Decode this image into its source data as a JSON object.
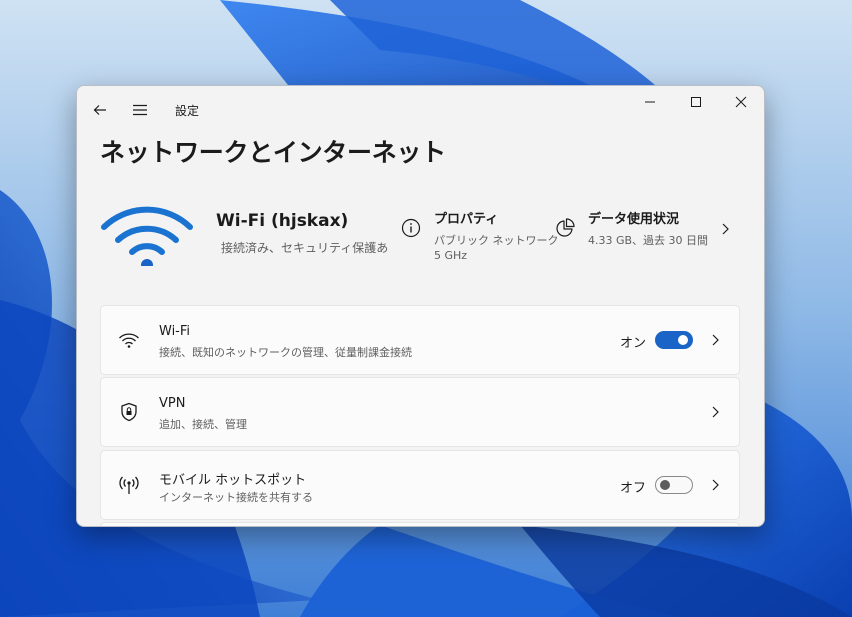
{
  "window": {
    "title": "設定"
  },
  "page": {
    "title": "ネットワークとインターネット"
  },
  "connection": {
    "name": "Wi-Fi (hjskax)",
    "status": "接続済み、セキュリティ保護あり"
  },
  "properties": {
    "title": "プロパティ",
    "line1": "パブリック ネットワーク",
    "line2": "5 GHz"
  },
  "data_usage": {
    "title": "データ使用状況",
    "detail": "4.33 GB、過去 30 日間"
  },
  "cards": [
    {
      "title": "Wi-Fi",
      "subtitle": "接続、既知のネットワークの管理、従量制課金接続",
      "toggle_label": "オン",
      "toggle_on": true,
      "icon": "wifi-icon"
    },
    {
      "title": "VPN",
      "subtitle": "追加、接続、管理",
      "icon": "vpn-shield-icon"
    },
    {
      "title": "モバイル ホットスポット",
      "subtitle": "インターネット接続を共有する",
      "toggle_label": "オフ",
      "toggle_on": false,
      "icon": "hotspot-icon"
    }
  ],
  "colors": {
    "accent": "#1a64c8",
    "window_bg": "#f3f3f3",
    "card_bg": "#fbfbfb"
  }
}
